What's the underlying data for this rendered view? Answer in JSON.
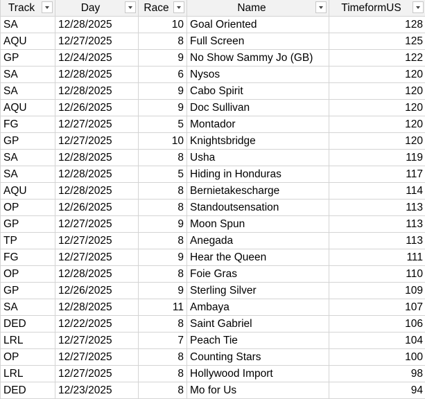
{
  "headers": {
    "track": "Track",
    "day": "Day",
    "race": "Race",
    "name": "Name",
    "timeform": "TimeformUS"
  },
  "rows": [
    {
      "track": "SA",
      "day": "12/28/2025",
      "race": "10",
      "name": "Goal Oriented",
      "tf": "128"
    },
    {
      "track": "AQU",
      "day": "12/27/2025",
      "race": "8",
      "name": "Full Screen",
      "tf": "125"
    },
    {
      "track": "GP",
      "day": "12/24/2025",
      "race": "9",
      "name": "No Show Sammy Jo (GB)",
      "tf": "122"
    },
    {
      "track": "SA",
      "day": "12/28/2025",
      "race": "6",
      "name": "Nysos",
      "tf": "120"
    },
    {
      "track": "SA",
      "day": "12/28/2025",
      "race": "9",
      "name": "Cabo Spirit",
      "tf": "120"
    },
    {
      "track": "AQU",
      "day": "12/26/2025",
      "race": "9",
      "name": "Doc Sullivan",
      "tf": "120"
    },
    {
      "track": "FG",
      "day": "12/27/2025",
      "race": "5",
      "name": "Montador",
      "tf": "120"
    },
    {
      "track": "GP",
      "day": "12/27/2025",
      "race": "10",
      "name": "Knightsbridge",
      "tf": "120"
    },
    {
      "track": "SA",
      "day": "12/28/2025",
      "race": "8",
      "name": "Usha",
      "tf": "119"
    },
    {
      "track": "SA",
      "day": "12/28/2025",
      "race": "5",
      "name": "Hiding in Honduras",
      "tf": "117"
    },
    {
      "track": "AQU",
      "day": "12/28/2025",
      "race": "8",
      "name": "Bernietakescharge",
      "tf": "114"
    },
    {
      "track": "OP",
      "day": "12/26/2025",
      "race": "8",
      "name": "Standoutsensation",
      "tf": "113"
    },
    {
      "track": "GP",
      "day": "12/27/2025",
      "race": "9",
      "name": "Moon Spun",
      "tf": "113"
    },
    {
      "track": "TP",
      "day": "12/27/2025",
      "race": "8",
      "name": "Anegada",
      "tf": "113"
    },
    {
      "track": "FG",
      "day": "12/27/2025",
      "race": "9",
      "name": "Hear the Queen",
      "tf": "111"
    },
    {
      "track": "OP",
      "day": "12/28/2025",
      "race": "8",
      "name": "Foie Gras",
      "tf": "110"
    },
    {
      "track": "GP",
      "day": "12/26/2025",
      "race": "9",
      "name": "Sterling Silver",
      "tf": "109"
    },
    {
      "track": "SA",
      "day": "12/28/2025",
      "race": "11",
      "name": "Ambaya",
      "tf": "107"
    },
    {
      "track": "DED",
      "day": "12/22/2025",
      "race": "8",
      "name": "Saint Gabriel",
      "tf": "106"
    },
    {
      "track": "LRL",
      "day": "12/27/2025",
      "race": "7",
      "name": "Peach Tie",
      "tf": "104"
    },
    {
      "track": "OP",
      "day": "12/27/2025",
      "race": "8",
      "name": "Counting Stars",
      "tf": "100"
    },
    {
      "track": "LRL",
      "day": "12/27/2025",
      "race": "8",
      "name": "Hollywood Import",
      "tf": "98"
    },
    {
      "track": "DED",
      "day": "12/23/2025",
      "race": "8",
      "name": "Mo for Us",
      "tf": "94"
    }
  ]
}
